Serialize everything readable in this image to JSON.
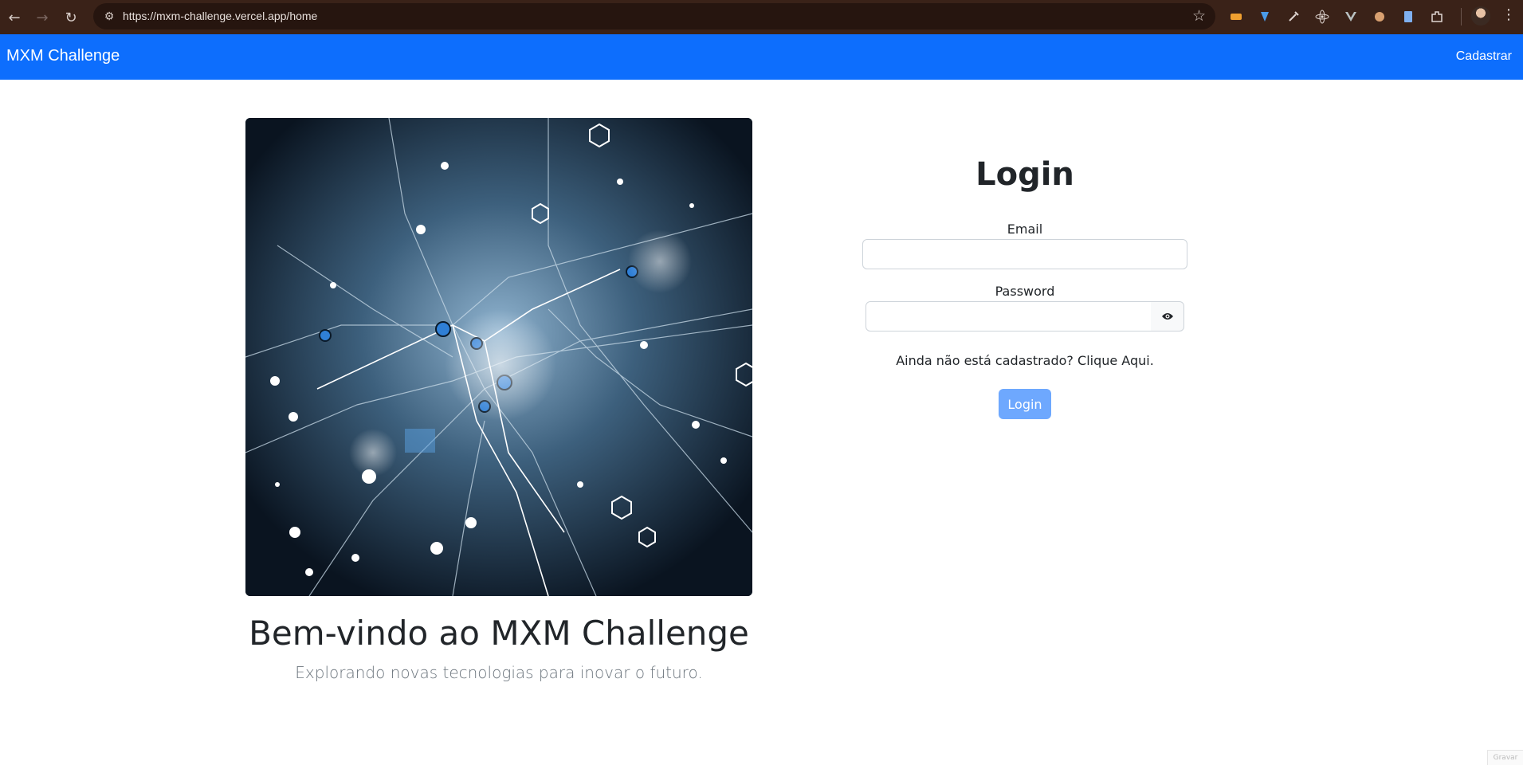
{
  "browser": {
    "url": "https://mxm-challenge.vercel.app/home",
    "back_icon": "arrow-left-icon",
    "forward_icon": "arrow-right-icon",
    "reload_icon": "reload-icon",
    "bookmark_icon": "star-icon"
  },
  "navbar": {
    "brand": "MXM Challenge",
    "link": "Cadastrar",
    "color": "#0d6efd"
  },
  "hero": {
    "title": "Bem-vindo ao MXM Challenge",
    "subtitle": "Explorando novas tecnologias para inovar o futuro."
  },
  "login": {
    "title": "Login",
    "email_label": "Email",
    "email_value": "",
    "password_label": "Password",
    "password_value": "",
    "signup_prompt": "Ainda não está cadastrado?",
    "signup_link": "Clique Aqui.",
    "submit": "Login",
    "submit_color": "#6ea8fe"
  },
  "corner_text": "Gravar"
}
